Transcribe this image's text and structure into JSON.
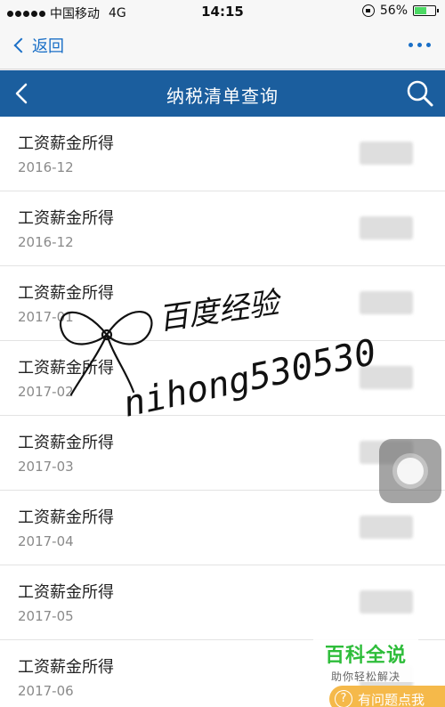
{
  "status_bar": {
    "carrier": "中国移动",
    "network": "4G",
    "time": "14:15",
    "battery": "56%",
    "battery_level": 0.56
  },
  "nav": {
    "back_label": "返回"
  },
  "header": {
    "title": "纳税清单查询"
  },
  "list": {
    "items": [
      {
        "title": "工资薪金所得",
        "date": "2016-12"
      },
      {
        "title": "工资薪金所得",
        "date": "2016-12"
      },
      {
        "title": "工资薪金所得",
        "date": "2017-01"
      },
      {
        "title": "工资薪金所得",
        "date": "2017-02"
      },
      {
        "title": "工资薪金所得",
        "date": "2017-03"
      },
      {
        "title": "工资薪金所得",
        "date": "2017-04"
      },
      {
        "title": "工资薪金所得",
        "date": "2017-05"
      },
      {
        "title": "工资薪金所得",
        "date": "2017-06"
      }
    ]
  },
  "watermark": {
    "line1": "百度经验",
    "line2": "nihong530530"
  },
  "baike": {
    "title": "百科全说",
    "subtitle": "助你轻松解决"
  },
  "help": {
    "label": "有问题点我",
    "icon": "?"
  },
  "colors": {
    "header_bg": "#1b5e9e",
    "link_blue": "#1a6fc7",
    "baike_green": "#2ebd3a",
    "help_orange": "#f5b94a"
  }
}
